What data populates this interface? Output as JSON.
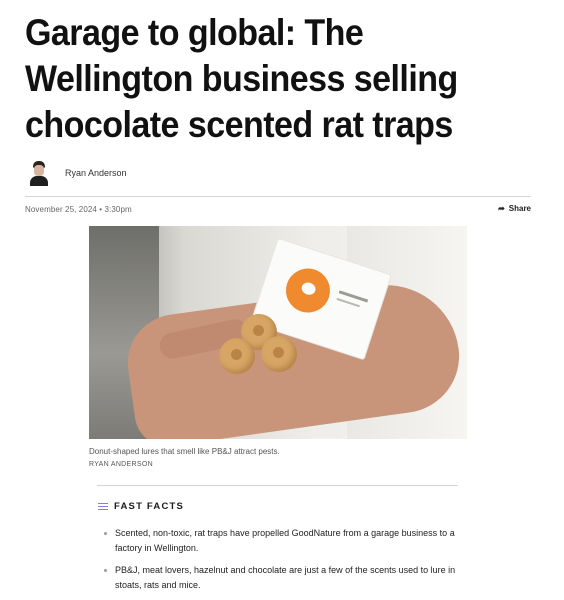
{
  "article": {
    "headline": "Garage to global: The Wellington business selling chocolate scented rat traps",
    "author": "Ryan Anderson",
    "date": "November 25, 2024 • 3:30pm",
    "share_label": "Share"
  },
  "photo": {
    "caption": "Donut-shaped lures that smell like PB&J attract pests.",
    "credit": "RYAN ANDERSON"
  },
  "fast_facts": {
    "title": "FAST FACTS",
    "items": [
      "Scented, non-toxic, rat traps have propelled GoodNature from a garage business to a factory in Wellington.",
      "PB&J, meat lovers, hazelnut and chocolate are just a few of the scents used to lure in stoats, rats and mice."
    ]
  },
  "icons": {
    "share": "share-arrow-icon",
    "list": "list-icon"
  },
  "colors": {
    "accent": "#8a7fd8",
    "packet_logo": "#f08a2e"
  }
}
